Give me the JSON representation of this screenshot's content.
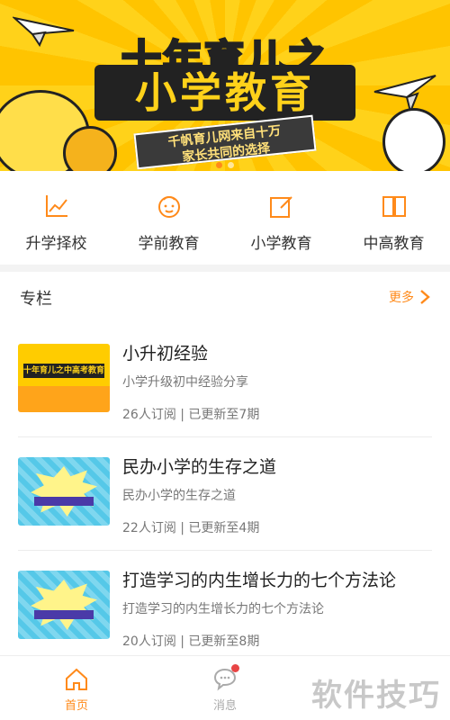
{
  "banner": {
    "title_top": "十年育儿之",
    "title_main": "小学教育",
    "ribbon_line1": "千帆育儿网来自十万",
    "ribbon_line2": "家长共同的选择"
  },
  "categories": [
    {
      "label": "升学择校",
      "icon": "line-chart-icon"
    },
    {
      "label": "学前教育",
      "icon": "baby-face-icon"
    },
    {
      "label": "小学教育",
      "icon": "edit-note-icon"
    },
    {
      "label": "中高教育",
      "icon": "book-icon"
    }
  ],
  "section": {
    "title": "专栏",
    "more": "更多"
  },
  "items": [
    {
      "title": "小升初经验",
      "subtitle": "小学升级初中经验分享",
      "meta": "26人订阅 | 已更新至7期",
      "thumb_text": "十年育儿之中高考教育"
    },
    {
      "title": "民办小学的生存之道",
      "subtitle": "民办小学的生存之道",
      "meta": "22人订阅 | 已更新至4期"
    },
    {
      "title": "打造学习的内生增长力的七个方法论",
      "subtitle": "打造学习的内生增长力的七个方法论",
      "meta": "20人订阅 | 已更新至8期"
    }
  ],
  "tabs": [
    {
      "label": "首页",
      "icon": "home-icon",
      "active": true
    },
    {
      "label": "消息",
      "icon": "chat-bubble-icon",
      "active": false
    }
  ],
  "watermark": "软件技巧",
  "colors": {
    "accent": "#ff8a1a",
    "banner_yellow": "#ffd21a",
    "badge": "#e84545"
  }
}
